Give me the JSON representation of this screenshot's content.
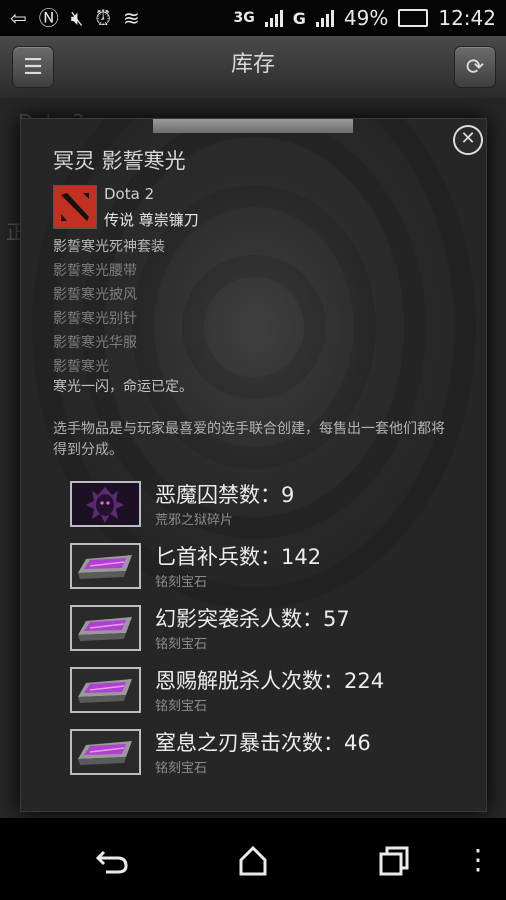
{
  "status_bar": {
    "icons": [
      "back-arrow-icon",
      "nfc-icon",
      "mute-icon",
      "alarm-icon",
      "wifi-icon",
      "3g-icon",
      "signal-icon",
      "g-icon",
      "signal-icon-2",
      "charging-icon"
    ],
    "network_3g": "3G",
    "network_g": "G",
    "battery_percent": "49%",
    "time": "12:42"
  },
  "action_bar": {
    "title": "库存",
    "menu_icon": "menu-icon",
    "refresh_icon": "refresh-icon"
  },
  "background": {
    "partial_text_1": "Dota 2",
    "partial_text_2": "正"
  },
  "dialog": {
    "title": "冥灵 影誓寒光",
    "game": "Dota 2",
    "item_type": "传说 尊崇镰刀",
    "set_name": "影誓寒光死神套装",
    "set_items": [
      "影誓寒光腰带",
      "影誓寒光披风",
      "影誓寒光别针",
      "影誓寒光华服",
      "影誓寒光"
    ],
    "flavor": "寒光一闪，命运已定。",
    "description": "选手物品是与玩家最喜爱的选手联合创建，每售出一套他们都将得到分成。",
    "stats": [
      {
        "label": "恶魔囚禁数：9",
        "sub": "荒邪之狱碎片"
      },
      {
        "label": "匕首补兵数：142",
        "sub": "铭刻宝石"
      },
      {
        "label": "幻影突袭杀人数：57",
        "sub": "铭刻宝石"
      },
      {
        "label": "恩赐解脱杀人次数：224",
        "sub": "铭刻宝石"
      },
      {
        "label": "窒息之刃暴击次数：46",
        "sub": "铭刻宝石"
      }
    ]
  },
  "colors": {
    "dota_red": "#c23022",
    "gem_purple": "#b040d0"
  }
}
